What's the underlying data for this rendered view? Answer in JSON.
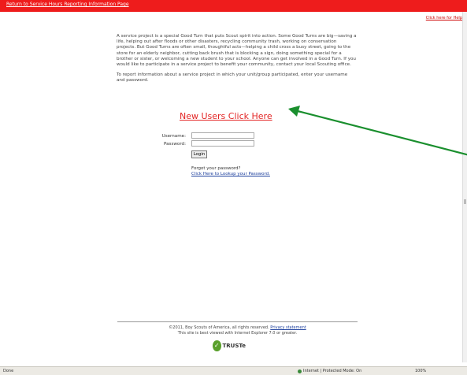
{
  "topbar": {
    "return_link": "Return to Service Hours Reporting Information Page",
    "help_link": "Click here for Help"
  },
  "intro": {
    "paragraph1": "A service project is a special Good Turn that puts Scout spirit into action. Some Good Turns are big—saving a life, helping out after floods or other disasters, recycling community trash, working on conservation projects. But Good Turns are often small, thoughtful acts—helping a child cross a busy street, going to the store for an elderly neighbor, cutting back brush that is blocking a sign, doing something special for a brother or sister, or welcoming a new student to your school. Anyone can get involved in a Good Turn. If you would like to participate in a service project to benefit your community, contact your local Scouting office.",
    "paragraph2": "To report information about a service project in which your unit/group participated, enter your username and password."
  },
  "new_users_link": "New Users Click Here",
  "login": {
    "username_label": "Username:",
    "password_label": "Password:",
    "username_value": "",
    "password_value": "",
    "login_button": "Login",
    "forgot_text": "Forgot your password?",
    "lookup_link": "Click Here to Lookup your Password."
  },
  "footer": {
    "copyright": "©2011, Boy Scouts of America, all rights reserved.",
    "privacy_link": "Privacy statement",
    "browser_note": "This site is best viewed with Internet Explorer 7.0 or greater.",
    "truste_text": "TRUSTe"
  },
  "statusbar": {
    "left": "Done",
    "zone": "Internet | Protected Mode: On",
    "zoom": "100%"
  },
  "annotation": {
    "arrow_color": "#1a8f2e"
  }
}
